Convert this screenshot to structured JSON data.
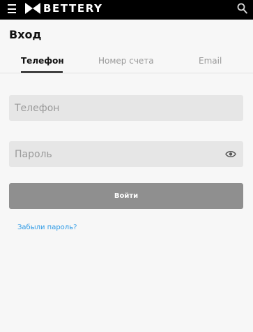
{
  "header": {
    "logo_text": "BETTERY",
    "menu_icon": "hamburger-menu-icon",
    "search_icon": "search-icon",
    "background": "#000000"
  },
  "page": {
    "title": "Вход"
  },
  "tabs": [
    {
      "label": "Телефон",
      "active": true
    },
    {
      "label": "Номер счета",
      "active": false
    },
    {
      "label": "Email",
      "active": false
    }
  ],
  "form": {
    "phone": {
      "placeholder": "Телефон",
      "value": ""
    },
    "password": {
      "placeholder": "Пароль",
      "value": "",
      "toggle_icon": "eye-icon"
    },
    "submit_label": "Войти",
    "forgot_label": "Забыли пароль?"
  },
  "colors": {
    "accent_link": "#2f9be6",
    "button_disabled": "#8f8f8f",
    "field_background": "#e6e6e6"
  }
}
